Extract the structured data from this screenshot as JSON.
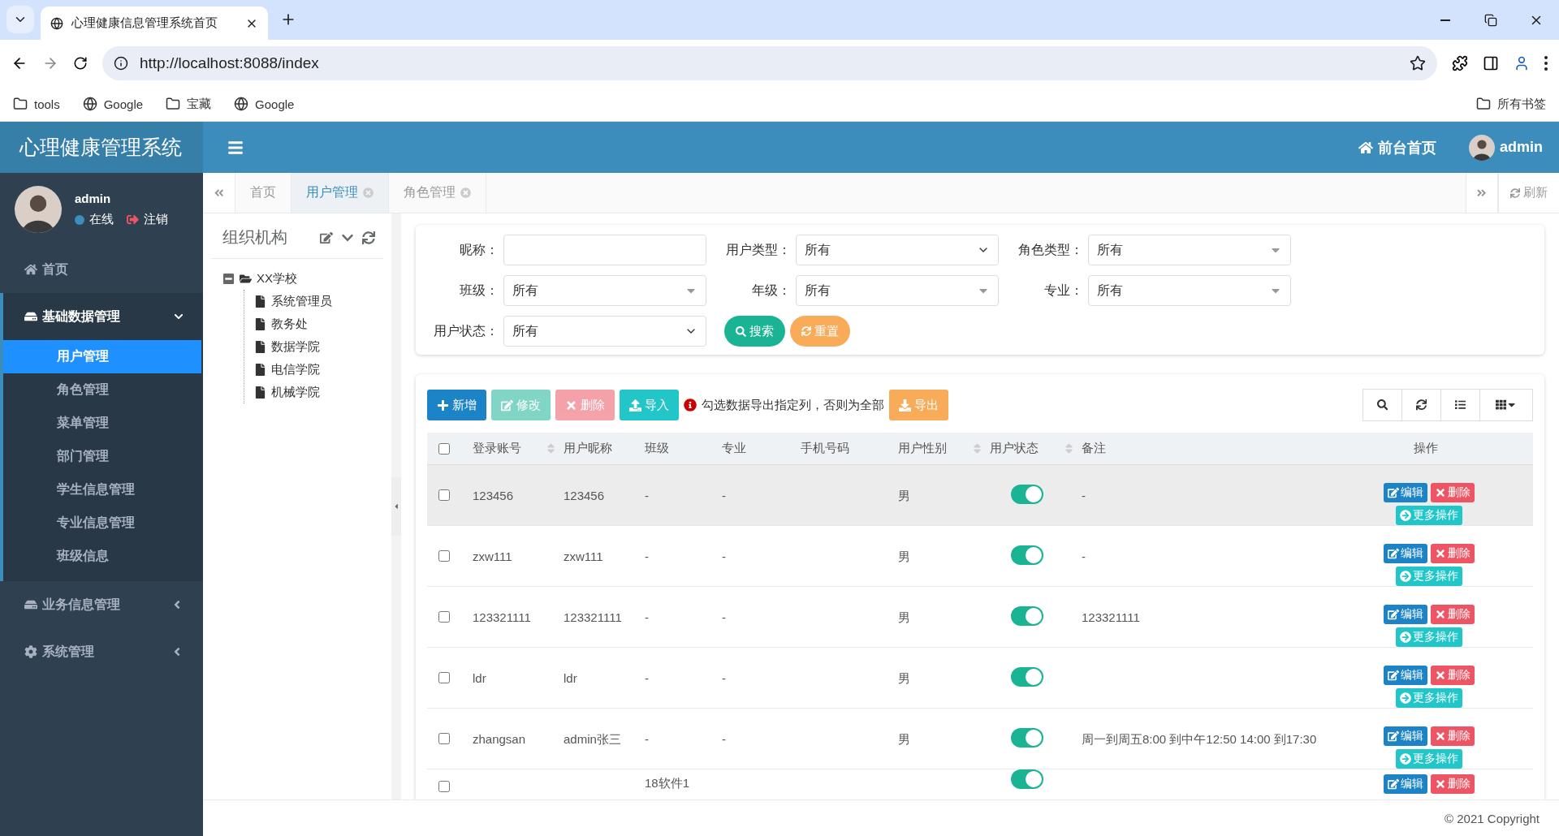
{
  "browser": {
    "tab_title": "心理健康信息管理系统首页",
    "url": "http://localhost:8088/index",
    "bookmarks": [
      "tools",
      "Google",
      "宝藏",
      "Google"
    ],
    "all_bookmarks": "所有书签"
  },
  "header": {
    "title": "心理健康管理系统",
    "home_link": "前台首页",
    "user": "admin"
  },
  "sidebar": {
    "user": {
      "name": "admin",
      "status": "在线",
      "logout": "注销"
    },
    "menu": [
      {
        "label": "首页",
        "expanded": false
      },
      {
        "label": "基础数据管理",
        "expanded": true,
        "children": [
          {
            "label": "用户管理",
            "selected": true
          },
          {
            "label": "角色管理",
            "selected": false
          },
          {
            "label": "菜单管理",
            "selected": false
          },
          {
            "label": "部门管理",
            "selected": false
          },
          {
            "label": "学生信息管理",
            "selected": false
          },
          {
            "label": "专业信息管理",
            "selected": false
          },
          {
            "label": "班级信息",
            "selected": false
          }
        ]
      },
      {
        "label": "业务信息管理",
        "expanded": false
      },
      {
        "label": "系统管理",
        "expanded": false
      }
    ]
  },
  "tabs": [
    {
      "label": "首页",
      "selected": false,
      "closable": false
    },
    {
      "label": "用户管理",
      "selected": true,
      "closable": true
    },
    {
      "label": "角色管理",
      "selected": false,
      "closable": true
    }
  ],
  "refresh": "刷新",
  "tree": {
    "title": "组织机构",
    "root": {
      "label": "XX学校",
      "expanded": true,
      "children": [
        {
          "label": "系统管理员"
        },
        {
          "label": "教务处"
        },
        {
          "label": "数据学院"
        },
        {
          "label": "电信学院"
        },
        {
          "label": "机械学院"
        }
      ]
    }
  },
  "search": {
    "fields": [
      {
        "label": "昵称：",
        "kind": "input"
      },
      {
        "label": "用户类型：",
        "kind": "select",
        "value": "所有"
      },
      {
        "label": "角色类型：",
        "kind": "dropdown",
        "value": "所有"
      },
      {
        "label": "班级：",
        "kind": "dropdown",
        "value": "所有"
      },
      {
        "label": "年级：",
        "kind": "dropdown",
        "value": "所有"
      },
      {
        "label": "专业：",
        "kind": "dropdown",
        "value": "所有"
      },
      {
        "label": "用户状态：",
        "kind": "select",
        "value": "所有"
      }
    ],
    "buttons": [
      {
        "label": "搜索",
        "kind": "success"
      },
      {
        "label": "重置",
        "kind": "warning"
      }
    ]
  },
  "toolbar": {
    "buttons": [
      {
        "label": "新增",
        "kind": "primary",
        "disabled": false
      },
      {
        "label": "修改",
        "kind": "success",
        "disabled": true
      },
      {
        "label": "删除",
        "kind": "danger",
        "disabled": true
      },
      {
        "label": "导入",
        "kind": "info",
        "disabled": false
      }
    ],
    "hint": "勾选数据导出指定列，否则为全部",
    "export": {
      "label": "导出",
      "kind": "warning",
      "disabled": false
    }
  },
  "table": {
    "select_all_checked": false,
    "columns": [
      {
        "label": "登录账号",
        "sortable": true
      },
      {
        "label": "用户昵称",
        "sortable": false
      },
      {
        "label": "班级",
        "sortable": false
      },
      {
        "label": "专业",
        "sortable": false
      },
      {
        "label": "手机号码",
        "sortable": false
      },
      {
        "label": "用户性别",
        "sortable": true
      },
      {
        "label": "用户状态",
        "sortable": true
      },
      {
        "label": "备注",
        "sortable": false
      },
      {
        "label": "操作",
        "sortable": false
      }
    ],
    "rows": [
      {
        "checked": false,
        "hovered": true,
        "account": "123456",
        "nickname": "123456",
        "class": "-",
        "major": "-",
        "phone": "",
        "gender": "男",
        "status_on": true,
        "remark": "-",
        "actions": [
          {
            "label": "编辑",
            "kind": "edit"
          },
          {
            "label": "删除",
            "kind": "delete"
          },
          {
            "label": "更多操作",
            "kind": "more"
          }
        ]
      },
      {
        "checked": false,
        "hovered": false,
        "account": "zxw111",
        "nickname": "zxw111",
        "class": "-",
        "major": "-",
        "phone": "",
        "gender": "男",
        "status_on": true,
        "remark": "-",
        "actions": [
          {
            "label": "编辑",
            "kind": "edit"
          },
          {
            "label": "删除",
            "kind": "delete"
          },
          {
            "label": "更多操作",
            "kind": "more"
          }
        ]
      },
      {
        "checked": false,
        "hovered": false,
        "account": "123321111",
        "nickname": "123321111",
        "class": "-",
        "major": "-",
        "phone": "",
        "gender": "男",
        "status_on": true,
        "remark": "123321111",
        "actions": [
          {
            "label": "编辑",
            "kind": "edit"
          },
          {
            "label": "删除",
            "kind": "delete"
          },
          {
            "label": "更多操作",
            "kind": "more"
          }
        ]
      },
      {
        "checked": false,
        "hovered": false,
        "account": "ldr",
        "nickname": "ldr",
        "class": "-",
        "major": "-",
        "phone": "",
        "gender": "男",
        "status_on": true,
        "remark": "",
        "actions": [
          {
            "label": "编辑",
            "kind": "edit"
          },
          {
            "label": "删除",
            "kind": "delete"
          },
          {
            "label": "更多操作",
            "kind": "more"
          }
        ]
      },
      {
        "checked": false,
        "hovered": false,
        "account": "zhangsan",
        "nickname": "admin张三",
        "class": "-",
        "major": "-",
        "phone": "",
        "gender": "男",
        "status_on": true,
        "remark": "周一到周五8:00 到中午12:50 14:00 到17:30",
        "actions": [
          {
            "label": "编辑",
            "kind": "edit"
          },
          {
            "label": "删除",
            "kind": "delete"
          },
          {
            "label": "更多操作",
            "kind": "more"
          }
        ]
      },
      {
        "checked": false,
        "hovered": false,
        "account": "",
        "nickname": "",
        "class": "18软件1",
        "major": "",
        "phone": "",
        "gender": "",
        "status_on": true,
        "remark": "",
        "actions": [
          {
            "label": "编辑",
            "kind": "edit"
          },
          {
            "label": "删除",
            "kind": "delete"
          }
        ]
      }
    ]
  },
  "footer": "© 2021 Copyright"
}
